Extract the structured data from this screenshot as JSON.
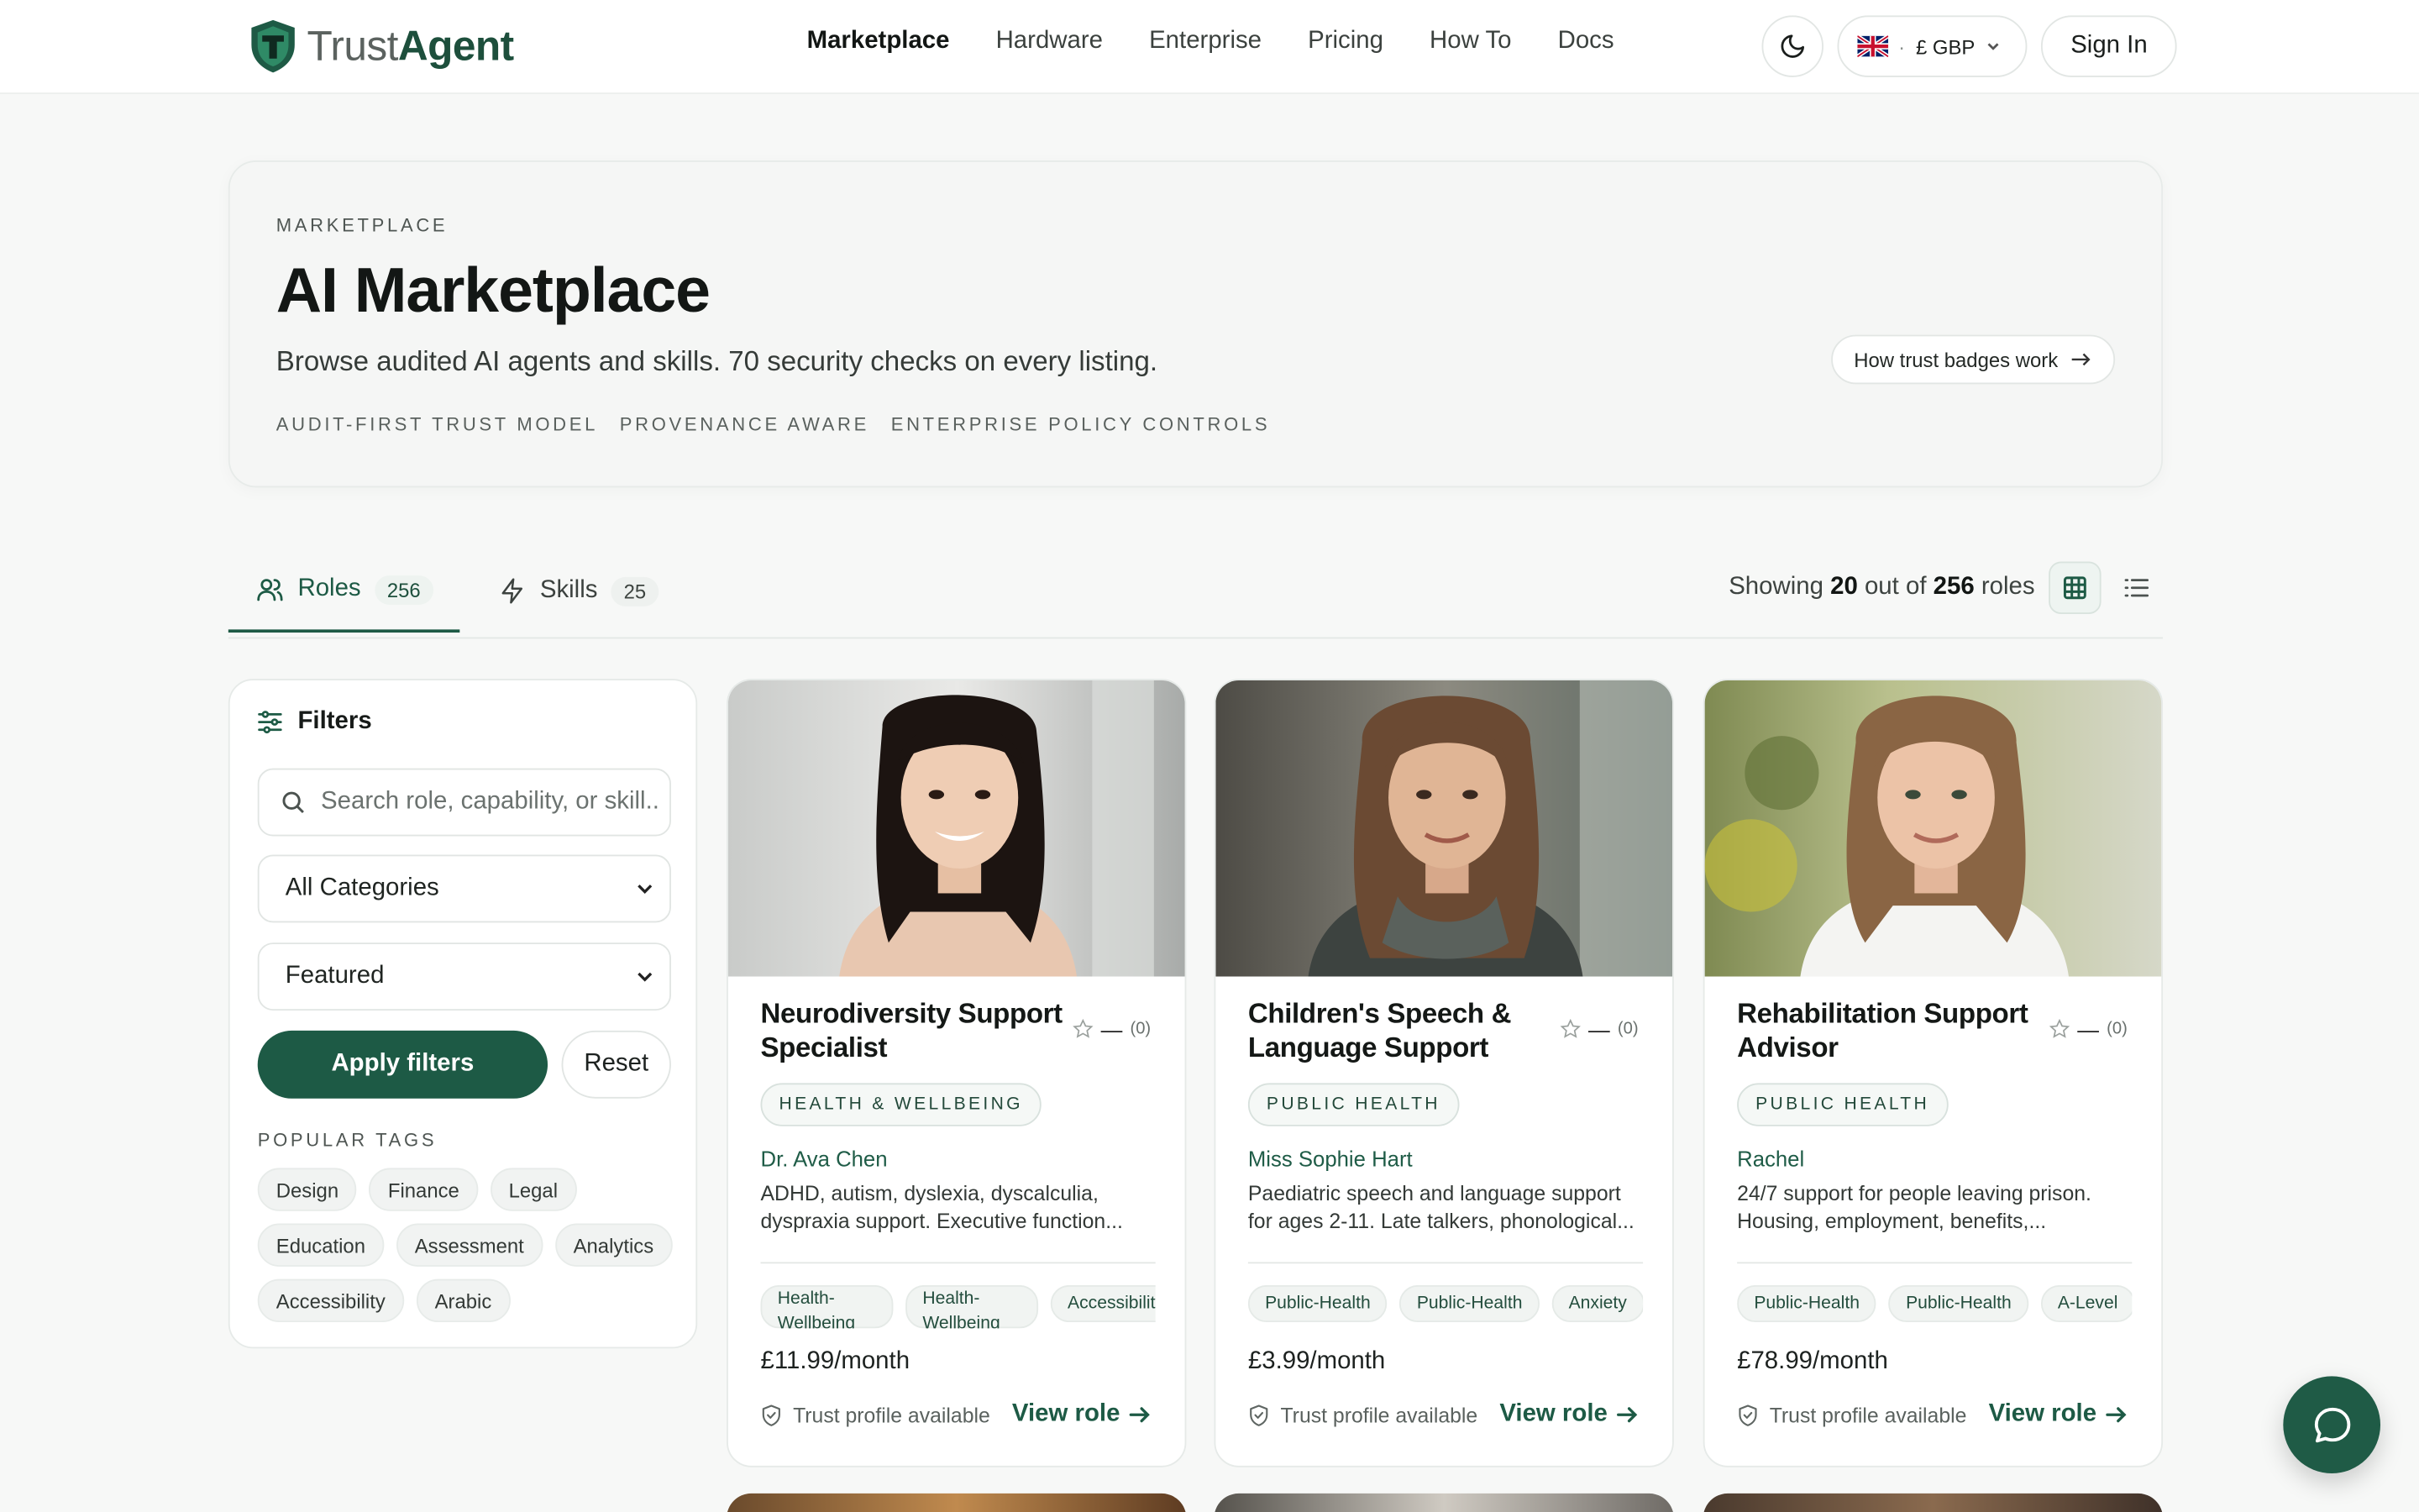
{
  "brand": {
    "name_part1": "Trust",
    "name_part2": "Agent"
  },
  "nav": [
    "Marketplace",
    "Hardware",
    "Enterprise",
    "Pricing",
    "How To",
    "Docs"
  ],
  "header": {
    "currency": "£ GBP",
    "currency_sep": "·",
    "sign_in": "Sign In"
  },
  "hero": {
    "eyebrow": "MARKETPLACE",
    "title": "AI Marketplace",
    "lead": "Browse audited AI agents and skills. 70 security checks on every listing.",
    "chips": [
      "AUDIT-FIRST TRUST MODEL",
      "PROVENANCE AWARE",
      "ENTERPRISE POLICY CONTROLS"
    ],
    "badge_link": "How trust badges work"
  },
  "tabs": {
    "roles_label": "Roles",
    "roles_count": "256",
    "skills_label": "Skills",
    "skills_count": "25",
    "showing_prefix": "Showing",
    "showing_n": "20",
    "showing_mid": "out of",
    "showing_total": "256",
    "showing_suffix": "roles"
  },
  "filters": {
    "title": "Filters",
    "search_placeholder": "Search role, capability, or skill...",
    "category": "All Categories",
    "sort": "Featured",
    "apply": "Apply filters",
    "reset": "Reset",
    "popular_title": "POPULAR TAGS",
    "tags": [
      "Design",
      "Finance",
      "Legal",
      "Education",
      "Assessment",
      "Analytics",
      "Accessibility",
      "Arabic"
    ]
  },
  "cards": [
    {
      "title": "Neurodiversity Support Specialist",
      "rating_dash": "—",
      "rating_count": "(0)",
      "category": "HEALTH & WELLBEING",
      "author": "Dr. Ava Chen",
      "description": "ADHD, autism, dyslexia, dyscalculia, dyspraxia support. Executive function...",
      "tags": [
        "Health-Wellbeing",
        "Health-Wellbeing",
        "Accessibility"
      ],
      "price": "£11.99/month",
      "trust": "Trust profile available",
      "view": "View role"
    },
    {
      "title": "Children's Speech & Language Support",
      "rating_dash": "—",
      "rating_count": "(0)",
      "category": "PUBLIC HEALTH",
      "author": "Miss Sophie Hart",
      "description": "Paediatric speech and language support for ages 2-11. Late talkers, phonological...",
      "tags": [
        "Public-Health",
        "Public-Health",
        "Anxiety"
      ],
      "price": "£3.99/month",
      "trust": "Trust profile available",
      "view": "View role"
    },
    {
      "title": "Rehabilitation Support Advisor",
      "rating_dash": "—",
      "rating_count": "(0)",
      "category": "PUBLIC HEALTH",
      "author": "Rachel",
      "description": "24/7 support for people leaving prison. Housing, employment, benefits,...",
      "tags": [
        "Public-Health",
        "Public-Health",
        "A-Level"
      ],
      "price": "£78.99/month",
      "trust": "Trust profile available",
      "view": "View role"
    }
  ],
  "colors": {
    "brand_green": "#1d5a45",
    "accent_text": "#1f5c47",
    "page_bg": "#f7f8f7"
  }
}
